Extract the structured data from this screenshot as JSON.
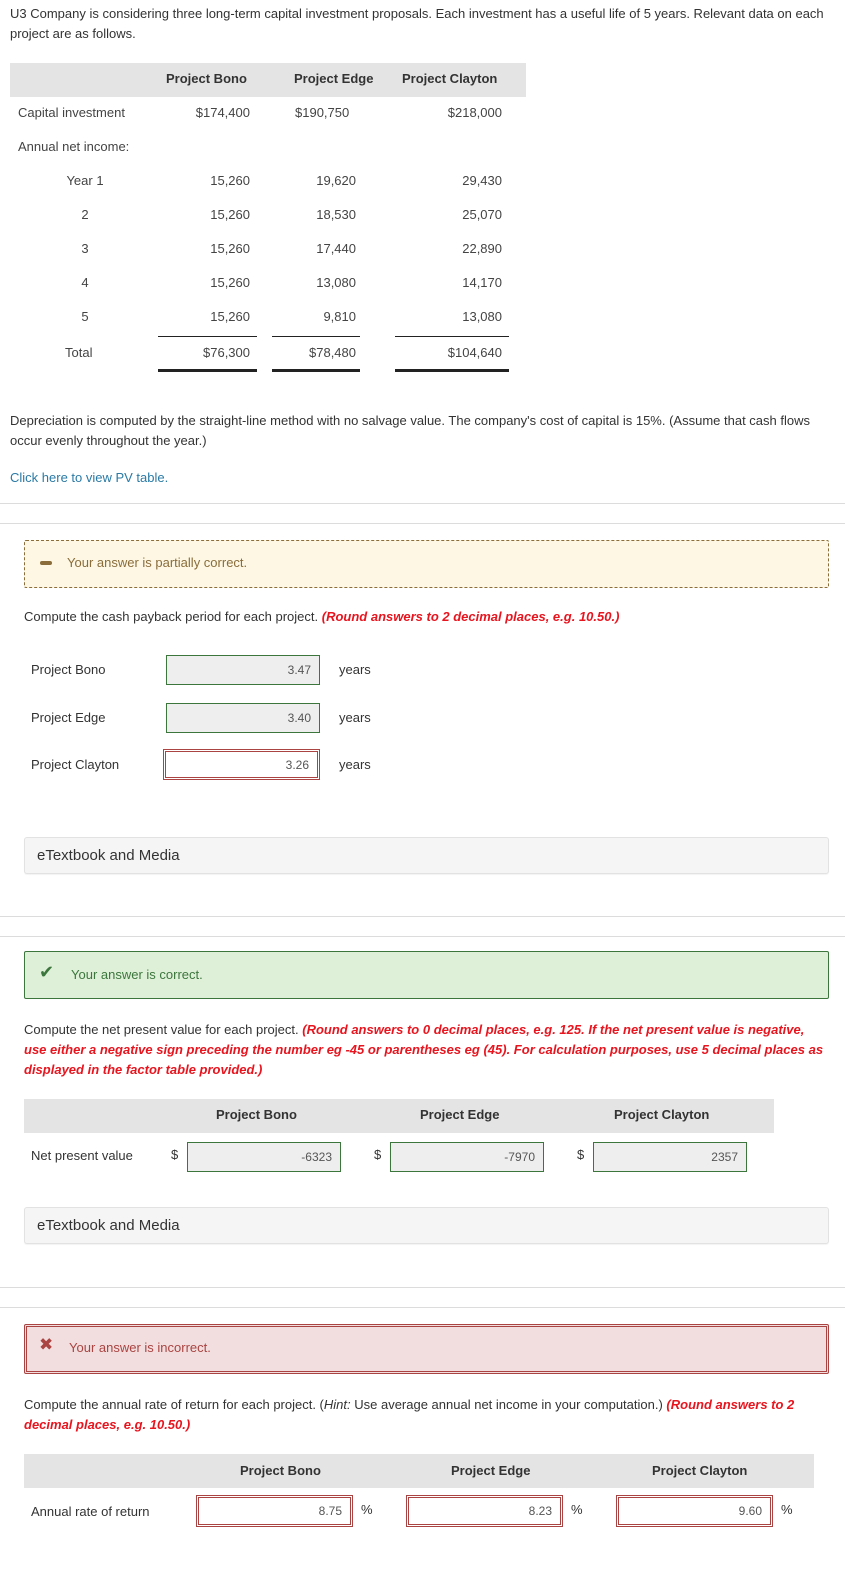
{
  "intro": "U3 Company is considering three long-term capital investment proposals. Each investment has a useful life of 5 years. Relevant data on each project are as follows.",
  "table": {
    "headers": [
      "Project Bono",
      "Project Edge",
      "Project Clayton"
    ],
    "capital_label": "Capital investment",
    "capital": [
      "$174,400",
      "$190,750",
      "$218,000"
    ],
    "income_label": "Annual net income:",
    "rows": [
      {
        "label": "Year  1",
        "values": [
          "15,260",
          "19,620",
          "29,430"
        ]
      },
      {
        "label": "2",
        "values": [
          "15,260",
          "18,530",
          "25,070"
        ]
      },
      {
        "label": "3",
        "values": [
          "15,260",
          "17,440",
          "22,890"
        ]
      },
      {
        "label": "4",
        "values": [
          "15,260",
          "13,080",
          "14,170"
        ]
      },
      {
        "label": "5",
        "values": [
          "15,260",
          "9,810",
          "13,080"
        ]
      }
    ],
    "total_label": "Total",
    "totals": [
      "$76,300",
      "$78,480",
      "$104,640"
    ]
  },
  "depreciation_note": "Depreciation is computed by the straight-line method with no salvage value. The company's cost of capital is 15%. (Assume that cash flows occur evenly throughout the year.)",
  "pv_link": "Click here to view PV table.",
  "part1": {
    "feedback": "Your answer is partially correct.",
    "feedback_status": "partial",
    "question": "Compute the cash payback period for each project.",
    "instruction": "(Round answers to 2 decimal places, e.g. 10.50.)",
    "rows": [
      {
        "label": "Project Bono",
        "value": "3.47",
        "unit": "years",
        "status": "correct"
      },
      {
        "label": "Project Edge",
        "value": "3.40",
        "unit": "years",
        "status": "correct"
      },
      {
        "label": "Project Clayton",
        "value": "3.26",
        "unit": "years",
        "status": "incorrect"
      }
    ],
    "etextbook": "eTextbook and Media"
  },
  "part2": {
    "feedback": "Your answer is correct.",
    "feedback_status": "correct",
    "question": "Compute the net present value for each project.",
    "instruction": "(Round answers to 0 decimal places, e.g. 125.  If the net present value is negative, use either a negative sign preceding the number eg -45 or parentheses eg (45). For calculation purposes, use 5 decimal places as displayed in the factor table provided.)",
    "headers": [
      "Project Bono",
      "Project Edge",
      "Project Clayton"
    ],
    "row_label": "Net present value",
    "currency": "$",
    "values": [
      "-6323",
      "-7970",
      "2357"
    ],
    "etextbook": "eTextbook and Media"
  },
  "part3": {
    "feedback": "Your answer is incorrect.",
    "feedback_status": "incorrect",
    "question_start": "Compute the annual rate of return for each project. (",
    "hint_label": "Hint:",
    "question_hint": " Use average annual net income in your computation.) ",
    "instruction": "(Round answers to 2 decimal places, e.g. 10.50.)",
    "headers": [
      "Project Bono",
      "Project Edge",
      "Project Clayton"
    ],
    "row_label": "Annual rate of return",
    "unit": "%",
    "values": [
      "8.75",
      "8.23",
      "9.60"
    ]
  },
  "colors": {
    "correct": "#3c763d",
    "incorrect": "#a94442",
    "partial": "#8a6d3b",
    "instruction_red": "#e8141e",
    "link": "#2a7aa5"
  }
}
